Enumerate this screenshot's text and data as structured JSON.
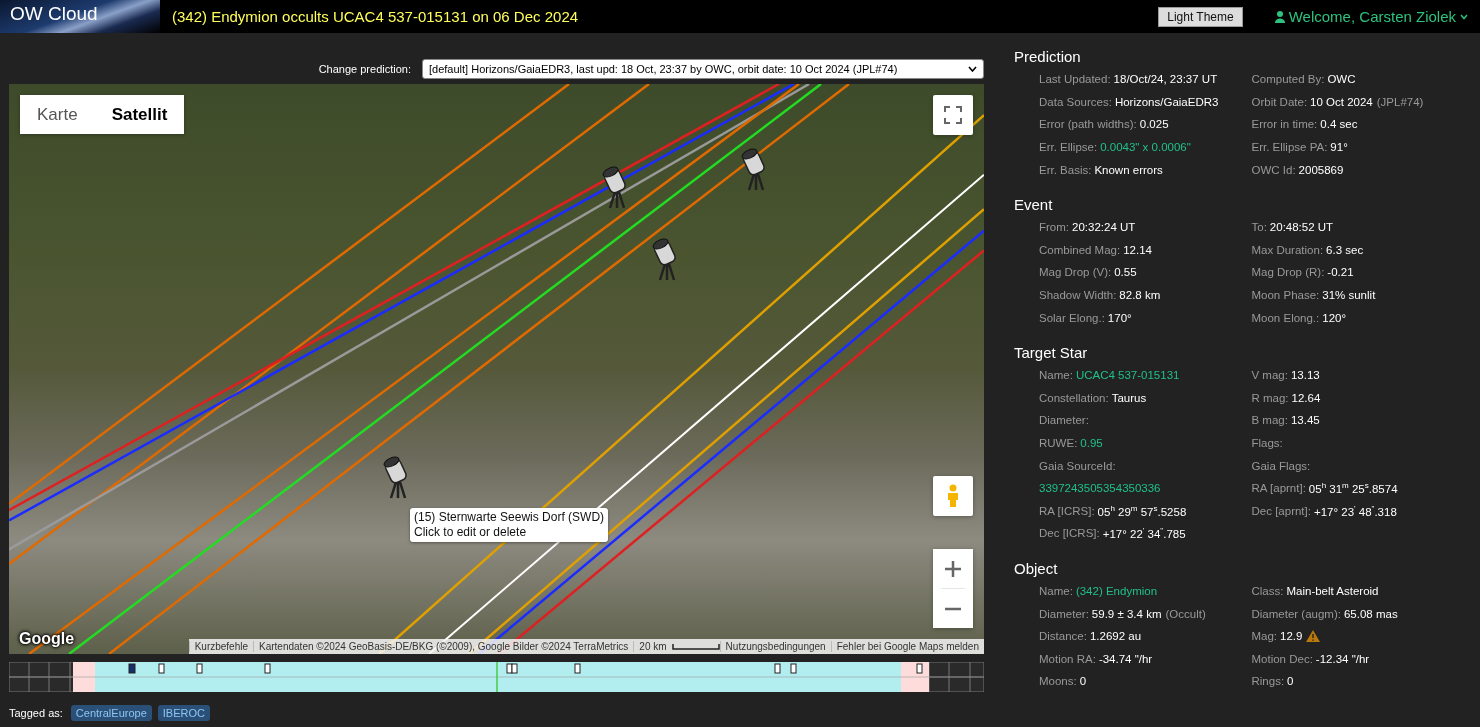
{
  "header": {
    "logo": "OW Cloud",
    "title": "(342) Endymion occults UCAC4 537-015131 on 06 Dec 2024",
    "theme_button": "Light Theme",
    "user": "Welcome, Carsten Ziolek"
  },
  "prediction_select": {
    "label": "Change prediction:",
    "value": "[default] Horizons/GaiaEDR3, last upd: 18 Oct, 23:37 by OWC, orbit date: 10 Oct 2024 (JPL#74)"
  },
  "map": {
    "tabs": [
      {
        "label": "Karte",
        "selected": false
      },
      {
        "label": "Satellit",
        "selected": true
      }
    ],
    "tooltip": [
      "(15) Sternwarte Seewis Dorf (SWD)",
      "Click to edit or delete"
    ],
    "logo": "Google",
    "attribution": [
      "Kurzbefehle",
      "Kartendaten ©2024 GeoBasis-DE/BKG (©2009), Google Bilder ©2024 TerraMetrics",
      "20 km",
      "Nutzungsbedingungen",
      "Fehler bei Google Maps melden"
    ]
  },
  "sections": [
    {
      "title": "Prediction",
      "rows": [
        [
          {
            "kind": "plain",
            "label": "Last Updated:",
            "value": "18/Oct/24, 23:37 UT"
          },
          {
            "kind": "plain",
            "label": "Computed By:",
            "value": "OWC"
          }
        ],
        [
          {
            "kind": "plain",
            "label": "Data Sources:",
            "value": "Horizons/GaiaEDR3"
          },
          {
            "kind": "plain",
            "label": "Orbit Date:",
            "value": "10 Oct 2024",
            "note": "(JPL#74)"
          }
        ],
        [
          {
            "kind": "plain",
            "label": "Error (path widths):",
            "value": "0.025"
          },
          {
            "kind": "plain",
            "label": "Error in time:",
            "value": "0.4 sec"
          }
        ],
        [
          {
            "kind": "link",
            "label": "Err. Ellipse:",
            "value": "0.0043\" x 0.0006\""
          },
          {
            "kind": "plain",
            "label": "Err. Ellipse PA:",
            "value": "91°"
          }
        ],
        [
          {
            "kind": "plain",
            "label": "Err. Basis:",
            "value": "Known errors"
          },
          {
            "kind": "plain",
            "label": "OWC Id:",
            "value": "2005869"
          }
        ]
      ]
    },
    {
      "title": "Event",
      "rows": [
        [
          {
            "kind": "plain",
            "label": "From:",
            "value": "20:32:24 UT"
          },
          {
            "kind": "plain",
            "label": "To:",
            "value": "20:48:52 UT"
          }
        ],
        [
          {
            "kind": "plain",
            "label": "Combined Mag:",
            "value": "12.14"
          },
          {
            "kind": "plain",
            "label": "Max Duration:",
            "value": "6.3 sec"
          }
        ],
        [
          {
            "kind": "plain",
            "label": "Mag Drop (V):",
            "value": "0.55"
          },
          {
            "kind": "plain",
            "label": "Mag Drop (R):",
            "value": "-0.21"
          }
        ],
        [
          {
            "kind": "plain",
            "label": "Shadow Width:",
            "value": "82.8 km"
          },
          {
            "kind": "plain",
            "label": "Moon Phase:",
            "value": "31% sunlit"
          }
        ],
        [
          {
            "kind": "plain",
            "label": "Solar Elong.:",
            "value": "170°"
          },
          {
            "kind": "plain",
            "label": "Moon Elong.:",
            "value": "120°"
          }
        ]
      ]
    },
    {
      "title": "Target Star",
      "rows": [
        [
          {
            "kind": "link",
            "label": "Name:",
            "value": "UCAC4 537-015131"
          },
          {
            "kind": "plain",
            "label": "V mag:",
            "value": "13.13"
          }
        ],
        [
          {
            "kind": "plain",
            "label": "Constellation:",
            "value": "Taurus"
          },
          {
            "kind": "plain",
            "label": "R mag:",
            "value": "12.64"
          }
        ],
        [
          {
            "kind": "plain",
            "label": "Diameter:"
          },
          {
            "kind": "plain",
            "label": "B mag:",
            "value": "13.45"
          }
        ],
        [
          {
            "kind": "link",
            "label": "RUWE:",
            "value": "0.95"
          },
          {
            "kind": "plain",
            "label": "Flags:"
          }
        ],
        [
          {
            "kind": "plain",
            "label": "Gaia SourceId:"
          },
          {
            "kind": "plain",
            "label": "Gaia Flags:"
          }
        ],
        [
          {
            "kind": "link",
            "value": "3397243505354350336"
          },
          {
            "kind": "plain",
            "label": "RA [aprnt]:",
            "value": "05$^{h}$ 31$^{m}$ 25$^{s}$.8574"
          }
        ],
        [
          {
            "kind": "plain",
            "label": "RA [ICRS]:",
            "value": "05$^{h}$ 29$^{m}$ 57$^{s}$.5258"
          },
          {
            "kind": "plain",
            "label": "Dec [aprnt]:",
            "value": "+17° 23$^{'}$ 48$^{\"}$.318"
          }
        ],
        [
          {
            "kind": "plain",
            "label": "Dec [ICRS]:",
            "value": "+17° 22$^{'}$ 34$^{\"}$.785"
          }
        ]
      ]
    },
    {
      "title": "Object",
      "rows": [
        [
          {
            "kind": "link",
            "label": "Name:",
            "value": "(342) Endymion"
          },
          {
            "kind": "plain",
            "label": "Class:",
            "value": "Main-belt Asteroid"
          }
        ],
        [
          {
            "kind": "plain",
            "label": "Diameter:",
            "value": "59.9 ± 3.4 km",
            "note": "(Occult)"
          },
          {
            "kind": "plain",
            "label": "Diameter (augm):",
            "value": "65.08 mas"
          }
        ],
        [
          {
            "kind": "plain",
            "label": "Distance:",
            "value": "1.2692 au"
          },
          {
            "kind": "warning",
            "label": "Mag:",
            "value": "12.9"
          }
        ],
        [
          {
            "kind": "plain",
            "label": "Motion RA:",
            "value": "-34.74 \"/hr"
          },
          {
            "kind": "plain",
            "label": "Motion Dec:",
            "value": "-12.34 \"/hr"
          }
        ],
        [
          {
            "kind": "plain",
            "label": "Moons:",
            "value": "0"
          },
          {
            "kind": "plain",
            "label": "Rings:",
            "value": "0"
          }
        ]
      ]
    }
  ],
  "tags": {
    "label": "Tagged as:",
    "items": [
      "CentralEurope",
      "IBEROC"
    ]
  }
}
